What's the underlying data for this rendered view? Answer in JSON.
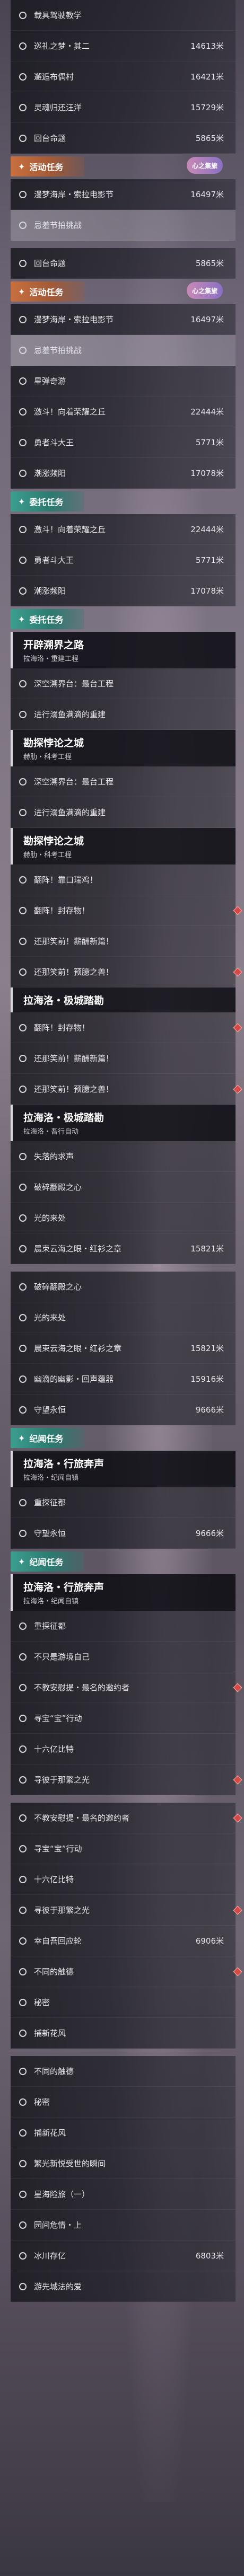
{
  "rows": [
    {
      "kind": "item",
      "name": "载具驾驶教学",
      "dist": "",
      "sel": false,
      "mark": false
    },
    {
      "kind": "item",
      "name": "巡礼之梦・其二",
      "dist": "14613米",
      "sel": false,
      "mark": false
    },
    {
      "kind": "item",
      "name": "邂逅布偶村",
      "dist": "16421米",
      "sel": false,
      "mark": false
    },
    {
      "kind": "item",
      "name": "灵魂归还汪洋",
      "dist": "15729米",
      "sel": false,
      "mark": false
    },
    {
      "kind": "item",
      "name": "回台命题",
      "dist": "5865米",
      "sel": false,
      "mark": false
    },
    {
      "kind": "hdr",
      "color": "orange",
      "icon": "✦",
      "title": "活动任务",
      "badge": "心之集旅"
    },
    {
      "kind": "item",
      "name": "漫梦海岸・索拉电影节",
      "dist": "16497米",
      "sel": false,
      "mark": false
    },
    {
      "kind": "item",
      "name": "忌羞节拍挑战",
      "dist": "",
      "sel": true,
      "mark": false
    },
    {
      "kind": "gap"
    },
    {
      "kind": "item",
      "name": "回台命题",
      "dist": "5865米",
      "sel": false,
      "mark": false
    },
    {
      "kind": "hdr",
      "color": "orange",
      "icon": "✦",
      "title": "活动任务",
      "badge": "心之集旅"
    },
    {
      "kind": "item",
      "name": "漫梦海岸・索拉电影节",
      "dist": "16497米",
      "sel": false,
      "mark": false
    },
    {
      "kind": "item",
      "name": "忌羞节拍挑战",
      "dist": "",
      "sel": true,
      "mark": false
    },
    {
      "kind": "item",
      "name": "星弹奇游",
      "dist": "",
      "sel": false,
      "mark": false
    },
    {
      "kind": "item",
      "name": "激斗！向着荣耀之丘",
      "dist": "22444米",
      "sel": false,
      "mark": false
    },
    {
      "kind": "item",
      "name": "勇者斗大王",
      "dist": "5771米",
      "sel": false,
      "mark": false
    },
    {
      "kind": "item",
      "name": "潮涨频阳",
      "dist": "17078米",
      "sel": false,
      "mark": false
    },
    {
      "kind": "hdr",
      "color": "teal",
      "icon": "✦",
      "title": "委托任务",
      "badge": ""
    },
    {
      "kind": "item",
      "name": "激斗！向着荣耀之丘",
      "dist": "22444米",
      "sel": false,
      "mark": false
    },
    {
      "kind": "item",
      "name": "勇者斗大王",
      "dist": "5771米",
      "sel": false,
      "mark": false
    },
    {
      "kind": "item",
      "name": "潮涨频阳",
      "dist": "17078米",
      "sel": false,
      "mark": false
    },
    {
      "kind": "hdr",
      "color": "teal",
      "icon": "✦",
      "title": "委托任务",
      "badge": ""
    },
    {
      "kind": "sub",
      "title": "开辟溯界之路",
      "subtitle": "拉海洛・重建工程"
    },
    {
      "kind": "item",
      "name": "深空溯界台：最台工程",
      "dist": "",
      "sel": false,
      "mark": false
    },
    {
      "kind": "item",
      "name": "进行溺鱼满滴的重建",
      "dist": "",
      "sel": false,
      "mark": false
    },
    {
      "kind": "sub",
      "title": "勘探悖论之城",
      "subtitle": "赫肋・科考工程"
    },
    {
      "kind": "item",
      "name": "深空溯界台：最台工程",
      "dist": "",
      "sel": false,
      "mark": false
    },
    {
      "kind": "item",
      "name": "进行溺鱼满滴的重建",
      "dist": "",
      "sel": false,
      "mark": false
    },
    {
      "kind": "sub",
      "title": "勘探悖论之城",
      "subtitle": "赫肋・科考工程"
    },
    {
      "kind": "item",
      "name": "翻阵！靠口瑞鸡！",
      "dist": "",
      "sel": false,
      "mark": false
    },
    {
      "kind": "item",
      "name": "翻阵！封存物！",
      "dist": "",
      "sel": false,
      "mark": true
    },
    {
      "kind": "item",
      "name": "还那笑前！薪酬新篇！",
      "dist": "",
      "sel": false,
      "mark": false
    },
    {
      "kind": "item",
      "name": "还那笑前！预臆之兽！",
      "dist": "",
      "sel": false,
      "mark": true
    },
    {
      "kind": "sub",
      "title": "拉海洛・极城踏勘",
      "subtitle": ""
    },
    {
      "kind": "item",
      "name": "翻阵！封存物！",
      "dist": "",
      "sel": false,
      "mark": true
    },
    {
      "kind": "item",
      "name": "还那笑前！薪酬新篇！",
      "dist": "",
      "sel": false,
      "mark": false
    },
    {
      "kind": "item",
      "name": "还那笑前！预臆之兽！",
      "dist": "",
      "sel": false,
      "mark": true
    },
    {
      "kind": "sub",
      "title": "拉海洛・极城踏勘",
      "subtitle": "拉海洛・吾行自动"
    },
    {
      "kind": "item",
      "name": "失落的求声",
      "dist": "",
      "sel": false,
      "mark": false
    },
    {
      "kind": "item",
      "name": "破碎翻殿之心",
      "dist": "",
      "sel": false,
      "mark": false
    },
    {
      "kind": "item",
      "name": "光的来处",
      "dist": "",
      "sel": false,
      "mark": false
    },
    {
      "kind": "item",
      "name": "晨束云海之眼・红衫之章",
      "dist": "15821米",
      "sel": false,
      "mark": false
    },
    {
      "kind": "gap"
    },
    {
      "kind": "item",
      "name": "破碎翻殿之心",
      "dist": "",
      "sel": false,
      "mark": false
    },
    {
      "kind": "item",
      "name": "光的来处",
      "dist": "",
      "sel": false,
      "mark": false
    },
    {
      "kind": "item",
      "name": "晨束云海之眼・红衫之章",
      "dist": "15821米",
      "sel": false,
      "mark": false
    },
    {
      "kind": "item",
      "name": "幽滴的幽影・回声蕴器",
      "dist": "15916米",
      "sel": false,
      "mark": false
    },
    {
      "kind": "item",
      "name": "守望永恒",
      "dist": "9666米",
      "sel": false,
      "mark": false
    },
    {
      "kind": "hdr",
      "color": "teal",
      "icon": "✦",
      "title": "纪闻任务",
      "badge": ""
    },
    {
      "kind": "sub",
      "title": "拉海洛・行旅奔声",
      "subtitle": "拉海洛・纪闻自镇"
    },
    {
      "kind": "item",
      "name": "重探征都",
      "dist": "",
      "sel": false,
      "mark": false
    },
    {
      "kind": "item",
      "name": "守望永恒",
      "dist": "9666米",
      "sel": false,
      "mark": false
    },
    {
      "kind": "hdr",
      "color": "teal",
      "icon": "✦",
      "title": "纪闻任务",
      "badge": ""
    },
    {
      "kind": "sub",
      "title": "拉海洛・行旅奔声",
      "subtitle": "拉海洛・纪闻自镇"
    },
    {
      "kind": "item",
      "name": "重探征都",
      "dist": "",
      "sel": false,
      "mark": false
    },
    {
      "kind": "item",
      "name": "不只是游境自己",
      "dist": "",
      "sel": false,
      "mark": false
    },
    {
      "kind": "item",
      "name": "不教安慰提・最名的邀约者",
      "dist": "",
      "sel": false,
      "mark": true
    },
    {
      "kind": "item",
      "name": "寻宝“宝”行动",
      "dist": "",
      "sel": false,
      "mark": false
    },
    {
      "kind": "item",
      "name": "十六亿比特",
      "dist": "",
      "sel": false,
      "mark": false
    },
    {
      "kind": "item",
      "name": "寻彼于那繁之光",
      "dist": "",
      "sel": false,
      "mark": true
    },
    {
      "kind": "gap"
    },
    {
      "kind": "item",
      "name": "不教安慰提・最名的邀约者",
      "dist": "",
      "sel": false,
      "mark": true
    },
    {
      "kind": "item",
      "name": "寻宝“宝”行动",
      "dist": "",
      "sel": false,
      "mark": false
    },
    {
      "kind": "item",
      "name": "十六亿比特",
      "dist": "",
      "sel": false,
      "mark": false
    },
    {
      "kind": "item",
      "name": "寻彼于那繁之光",
      "dist": "",
      "sel": false,
      "mark": true
    },
    {
      "kind": "item",
      "name": "幸自吾回应轮",
      "dist": "6906米",
      "sel": false,
      "mark": false
    },
    {
      "kind": "item",
      "name": "不同的触德",
      "dist": "",
      "sel": false,
      "mark": true
    },
    {
      "kind": "item",
      "name": "秘密",
      "dist": "",
      "sel": false,
      "mark": false
    },
    {
      "kind": "item",
      "name": "捕新花风",
      "dist": "",
      "sel": false,
      "mark": false
    },
    {
      "kind": "gap"
    },
    {
      "kind": "item",
      "name": "不同的触德",
      "dist": "",
      "sel": false,
      "mark": false
    },
    {
      "kind": "item",
      "name": "秘密",
      "dist": "",
      "sel": false,
      "mark": false
    },
    {
      "kind": "item",
      "name": "捕新花风",
      "dist": "",
      "sel": false,
      "mark": false
    },
    {
      "kind": "item",
      "name": "繁光新悦受世的瞬间",
      "dist": "",
      "sel": false,
      "mark": false
    },
    {
      "kind": "item",
      "name": "星海险旅（一）",
      "dist": "",
      "sel": false,
      "mark": false
    },
    {
      "kind": "item",
      "name": "园间危情・上",
      "dist": "",
      "sel": false,
      "mark": false
    },
    {
      "kind": "item",
      "name": "冰川存亿",
      "dist": "6803米",
      "sel": false,
      "mark": false
    },
    {
      "kind": "item",
      "name": "游先城法的爱",
      "dist": "",
      "sel": false,
      "mark": false
    }
  ]
}
